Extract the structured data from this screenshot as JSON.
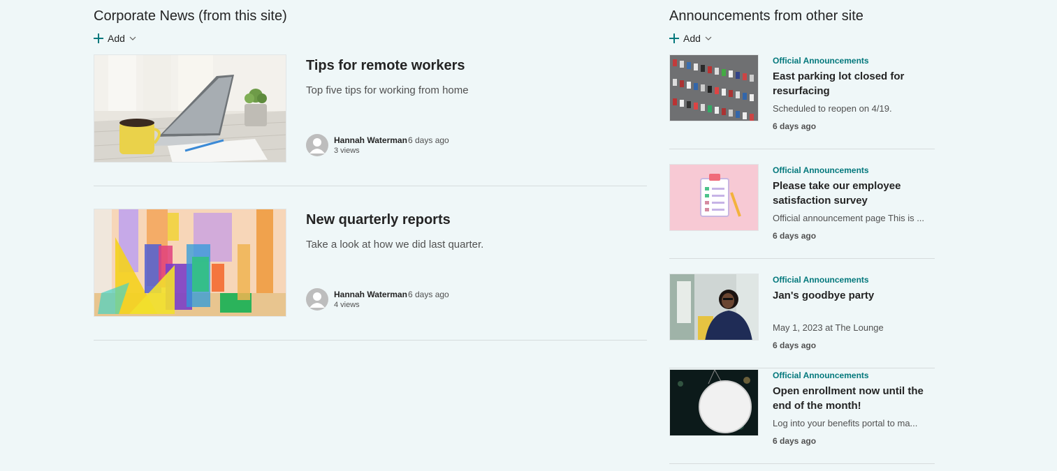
{
  "left_section": {
    "title": "Corporate News (from this site)",
    "add_label": "Add",
    "items": [
      {
        "title": "Tips for remote workers",
        "description": "Top five tips for working from home",
        "author": "Hannah Waterman",
        "date": "6 days ago",
        "views": "3 views",
        "image": "laptop-desk-image"
      },
      {
        "title": "New quarterly reports",
        "description": "Take a look at how we did last quarter.",
        "author": "Hannah Waterman",
        "date": "6 days ago",
        "views": "4 views",
        "image": "colorful-shapes-image"
      }
    ]
  },
  "right_section": {
    "title": "Announcements from other site",
    "add_label": "Add",
    "items": [
      {
        "category": "Official Announcements",
        "title": "East parking lot closed for resurfacing",
        "description": "Scheduled to reopen on 4/19.",
        "date": "6 days ago",
        "image": "parking-lot-image"
      },
      {
        "category": "Official Announcements",
        "title": "Please take our employee satisfaction survey",
        "description": "Official announcement page This is ...",
        "date": "6 days ago",
        "image": "survey-clipboard-image"
      },
      {
        "category": "Official Announcements",
        "title": "Jan's goodbye party",
        "description": "May 1, 2023 at The Lounge",
        "date": "6 days ago",
        "image": "smiling-person-image"
      },
      {
        "category": "Official Announcements",
        "title": "Open enrollment now until the end of the month!",
        "description": "Log into your benefits portal to ma...",
        "date": "6 days ago",
        "image": "open-sign-image"
      }
    ]
  },
  "colors": {
    "background": "#eff7f8",
    "accent": "#03787c",
    "text": "#242424",
    "secondary_text": "#505050",
    "divider": "#d6dcdd"
  }
}
